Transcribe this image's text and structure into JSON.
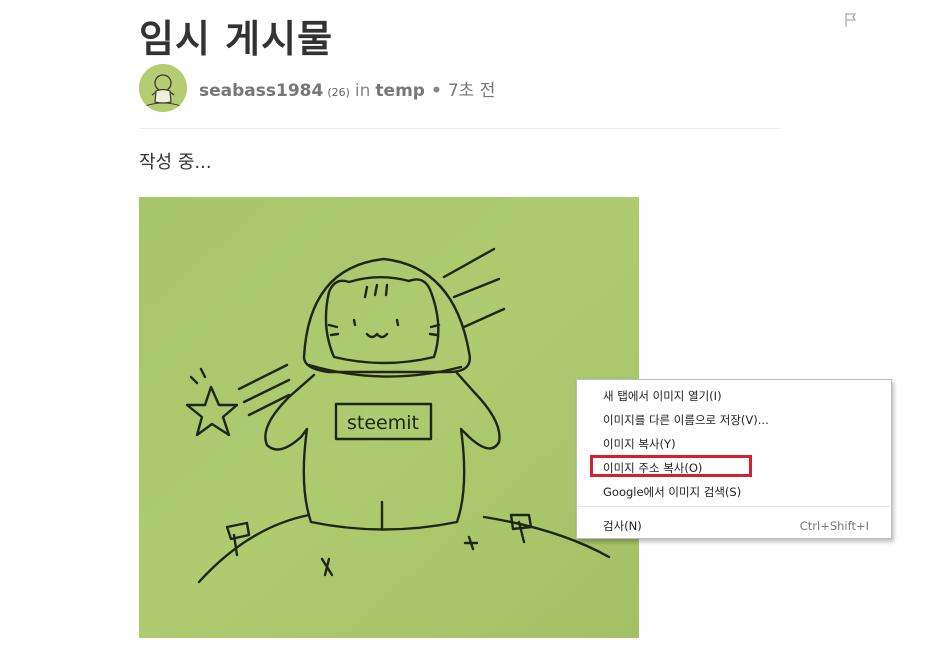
{
  "post": {
    "title": "임시 게시물",
    "body": "작성 중...",
    "author": {
      "name": "seabass1984",
      "reputation": "(26)",
      "in_word": "in",
      "category": "temp",
      "separator": "•",
      "time": "7초 전"
    },
    "image_text": "steemit"
  },
  "context_menu": {
    "items": [
      {
        "label": "새 탭에서 이미지 열기(I)",
        "shortcut": ""
      },
      {
        "label": "이미지를 다른 이름으로 저장(V)...",
        "shortcut": ""
      },
      {
        "label": "이미지 복사(Y)",
        "shortcut": ""
      },
      {
        "label": "이미지 주소 복사(O)",
        "shortcut": "",
        "highlighted": true
      },
      {
        "label": "Google에서 이미지 검색(S)",
        "shortcut": ""
      },
      {
        "label": "검사(N)",
        "shortcut": "Ctrl+Shift+I"
      }
    ]
  },
  "colors": {
    "highlight": "#d4202f",
    "paper": "#a9c66a",
    "ink": "#1e2618"
  },
  "icons": {
    "flag": "flag-icon"
  }
}
